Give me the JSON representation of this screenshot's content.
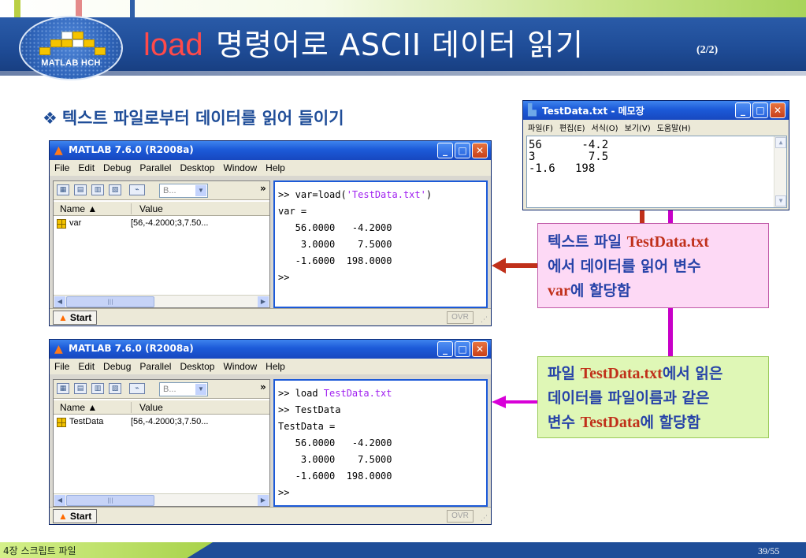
{
  "slide": {
    "logo_text": "MATLAB HCH",
    "title_cmd": "load",
    "title_rest": "명령어로 ASCII 데이터 읽기",
    "title_page": "(2/2)",
    "bullet": "텍스트 파일로부터 데이터를 읽어 들이기",
    "footer_left": "4장 스크립트 파일",
    "footer_page": "39/55"
  },
  "matlab_window_1": {
    "title": "MATLAB  7.6.0 (R2008a)",
    "menus": [
      "File",
      "Edit",
      "Debug",
      "Parallel",
      "Desktop",
      "Window",
      "Help"
    ],
    "combo": "B...",
    "more": "»",
    "col_name": "Name ▲",
    "col_value": "Value",
    "var_name": "var",
    "var_value": "[56,-4.2000;3,7.50...",
    "cmd_lines": [
      {
        "pre": ">> var=load(",
        "str": "'TestData.txt'",
        "post": ")"
      },
      {
        "text": "var ="
      },
      {
        "text": "   56.0000   -4.2000"
      },
      {
        "text": "    3.0000    7.5000"
      },
      {
        "text": "   -1.6000  198.0000"
      },
      {
        "text": ">>"
      }
    ],
    "start": "Start",
    "ovr": "OVR"
  },
  "matlab_window_2": {
    "title": "MATLAB  7.6.0 (R2008a)",
    "menus": [
      "File",
      "Edit",
      "Debug",
      "Parallel",
      "Desktop",
      "Window",
      "Help"
    ],
    "combo": "B...",
    "more": "»",
    "col_name": "Name ▲",
    "col_value": "Value",
    "var_name": "TestData",
    "var_value": "[56,-4.2000;3,7.50...",
    "cmd_lines": [
      {
        "pre": ">> load ",
        "str": "TestData.txt",
        "post": ""
      },
      {
        "text": ">> TestData"
      },
      {
        "text": "TestData ="
      },
      {
        "text": "   56.0000   -4.2000"
      },
      {
        "text": "    3.0000    7.5000"
      },
      {
        "text": "   -1.6000  198.0000"
      },
      {
        "text": ">>"
      }
    ],
    "start": "Start",
    "ovr": "OVR"
  },
  "notepad": {
    "title": "TestData.txt - 메모장",
    "menus": [
      "파일(F)",
      "편집(E)",
      "서식(O)",
      "보기(V)",
      "도움말(H)"
    ],
    "lines": [
      "56      -4.2",
      "3        7.5",
      "-1.6   198"
    ]
  },
  "callout_1": {
    "t1": "텍스트 파일 ",
    "h1": "TestData.txt",
    "t2": "에서 데이터를 읽어 변수",
    "h2": "var",
    "t3": "에 할당함"
  },
  "callout_2": {
    "t1": "파일 ",
    "h1": "TestData.txt",
    "t2": "에서 읽은",
    "t3": "데이터를 파일이름과 같은",
    "t4": "변수 ",
    "h2": "TestData",
    "t5": "에 할당함"
  },
  "colors": {
    "title_bar": "#1f4d98",
    "title_cmd": "#ff4a4a",
    "bullet": "#1f4d98",
    "highlight": "#c0301a",
    "callout_text": "#2743a8",
    "callout_1_bg": "#fdd9f5",
    "callout_2_bg": "#dff7b6",
    "matlab_string": "#a020f0",
    "arrow_red": "#c0301a",
    "arrow_magenta": "#d800d8"
  },
  "icons": [
    "matlab-logo-icon",
    "notepad-icon",
    "grid-variable-icon",
    "minimize-icon",
    "maximize-icon",
    "close-icon",
    "start-icon",
    "diamond-bullet-icon"
  ]
}
